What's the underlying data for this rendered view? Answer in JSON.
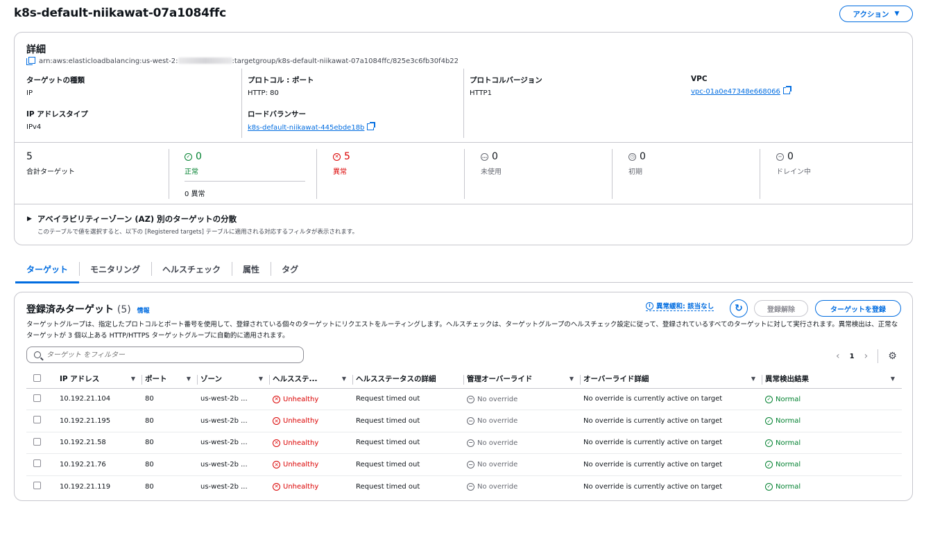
{
  "page": {
    "title": "k8s-default-niikawat-07a1084ffc",
    "actions_label": "アクション"
  },
  "details": {
    "heading": "詳細",
    "arn_prefix": "arn:aws:elasticloadbalancing:us-west-2:",
    "arn_suffix": ":targetgroup/k8s-default-niikawat-07a1084ffc/825e3c6fb30f4b22",
    "target_type_label": "ターゲットの種類",
    "target_type": "IP",
    "protocol_label": "プロトコル : ポート",
    "protocol": "HTTP: 80",
    "protocol_version_label": "プロトコルバージョン",
    "protocol_version": "HTTP1",
    "vpc_label": "VPC",
    "vpc": "vpc-01a0e47348e668066",
    "ip_type_label": "IP アドレスタイプ",
    "ip_type": "IPv4",
    "lb_label": "ロードバランサー",
    "lb": "k8s-default-niikawat-445ebde18b"
  },
  "stats": {
    "total": "5",
    "total_label": "合計ターゲット",
    "healthy": "0",
    "healthy_label": "正常",
    "healthy_sub": "0 異常",
    "unhealthy": "5",
    "unhealthy_label": "異常",
    "unused": "0",
    "unused_label": "未使用",
    "initial": "0",
    "initial_label": "初期",
    "draining": "0",
    "draining_label": "ドレイン中"
  },
  "az": {
    "title": "アベイラビリティーゾーン (AZ) 別のターゲットの分散",
    "subtitle": "このテーブルで値を選択すると、以下の [Registered targets] テーブルに適用される対応するフィルタが表示されます。"
  },
  "tabs": [
    "ターゲット",
    "モニタリング",
    "ヘルスチェック",
    "属性",
    "タグ"
  ],
  "targets": {
    "title": "登録済みターゲット",
    "count": "(5)",
    "info": "情報",
    "anomaly": "異常緩和: 該当なし",
    "dereg_label": "登録解除",
    "reg_label": "ターゲットを登録",
    "description": "ターゲットグループは、指定したプロトコルとポート番号を使用して、登録されている個々のターゲットにリクエストをルーティングします。ヘルスチェックは、ターゲットグループのヘルスチェック設定に従って、登録されているすべてのターゲットに対して実行されます。異常検出は、正常なターゲットが 3 個以上ある HTTP/HTTPS ターゲットグループに自動的に適用されます。",
    "filter_placeholder": "ターゲット をフィルター",
    "page": "1",
    "columns": [
      "IP アドレス",
      "ポート",
      "ゾーン",
      "ヘルスステ...",
      "ヘルスステータスの詳細",
      "管理オーバーライド",
      "オーバーライド詳細",
      "異常検出結果"
    ],
    "rows": [
      {
        "ip": "10.192.21.104",
        "port": "80",
        "zone": "us-west-2b ...",
        "health": "Unhealthy",
        "detail": "Request timed out",
        "override": "No override",
        "override_detail": "No override is currently active on target",
        "anomaly": "Normal"
      },
      {
        "ip": "10.192.21.195",
        "port": "80",
        "zone": "us-west-2b ...",
        "health": "Unhealthy",
        "detail": "Request timed out",
        "override": "No override",
        "override_detail": "No override is currently active on target",
        "anomaly": "Normal"
      },
      {
        "ip": "10.192.21.58",
        "port": "80",
        "zone": "us-west-2b ...",
        "health": "Unhealthy",
        "detail": "Request timed out",
        "override": "No override",
        "override_detail": "No override is currently active on target",
        "anomaly": "Normal"
      },
      {
        "ip": "10.192.21.76",
        "port": "80",
        "zone": "us-west-2b ...",
        "health": "Unhealthy",
        "detail": "Request timed out",
        "override": "No override",
        "override_detail": "No override is currently active on target",
        "anomaly": "Normal"
      },
      {
        "ip": "10.192.21.119",
        "port": "80",
        "zone": "us-west-2b ...",
        "health": "Unhealthy",
        "detail": "Request timed out",
        "override": "No override",
        "override_detail": "No override is currently active on target",
        "anomaly": "Normal"
      }
    ]
  },
  "colors": {
    "accent": "#006ce0",
    "ok": "#00802f",
    "bad": "#db0000"
  }
}
